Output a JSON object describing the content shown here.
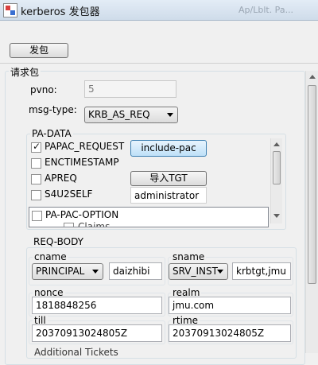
{
  "window": {
    "title": "kerberos 发包器",
    "ghost_text": "Ap/Lblt. Pa..."
  },
  "toolbar": {
    "send_label": "发包"
  },
  "request": {
    "group_label": "请求包",
    "pvno_label": "pvno:",
    "pvno_value": "5",
    "msgtype_label": "msg-type:",
    "msgtype_value": "KRB_AS_REQ"
  },
  "padata": {
    "group_label": "PA-DATA",
    "items": [
      {
        "label": "PAPAC_REQUEST",
        "checked": true
      },
      {
        "label": "ENCTIMESTAMP",
        "checked": false
      },
      {
        "label": "APREQ",
        "checked": false
      },
      {
        "label": "S4U2SELF",
        "checked": false
      }
    ],
    "include_pac_label": "include-pac",
    "import_tgt_label": "导入TGT",
    "user_value": "administrator",
    "pac_option_label": "PA-PAC-OPTION",
    "claims_partial": "Claims"
  },
  "reqbody": {
    "group_label": "REQ-BODY",
    "cname_label": "cname",
    "cname_type": "PRINCIPAL",
    "cname_value": "daizhibi",
    "sname_label": "sname",
    "sname_type": "SRV_INST",
    "sname_value": "krbtgt,jmu",
    "nonce_label": "nonce",
    "nonce_value": "1818848256",
    "realm_label": "realm",
    "realm_value": "jmu.com",
    "till_label": "till",
    "till_value": "20370913024805Z",
    "rtime_label": "rtime",
    "rtime_value": "20370913024805Z",
    "additional_tickets_partial": "Additional Tickets"
  }
}
